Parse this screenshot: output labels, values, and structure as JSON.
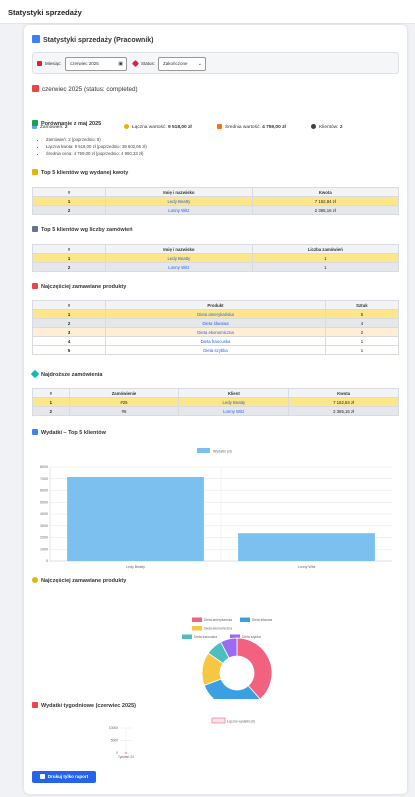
{
  "page_title": "Statystyki sprzedaży",
  "report_title": "Statystyki sprzedaży (Pracownik)",
  "filter": {
    "month_label": "Miesiąc:",
    "month_value": "czerwiec 2025",
    "status_label": "Status:",
    "status_value": "Zakończone"
  },
  "period_heading": "czerwiec 2025 (status: completed)",
  "stats": {
    "orders_label": "Zamówień:",
    "orders_value": "2",
    "total_label": "Łączna wartość:",
    "total_value": "9 518,00 zł",
    "avg_label": "Średnia wartość:",
    "avg_value": "4 759,00 zł",
    "clients_label": "Klientów:",
    "clients_value": "2"
  },
  "comparison": {
    "heading": "Porównanie z maj 2025",
    "items": [
      "Zamówień: 2 (poprzednio: 8)",
      "Łączna kwota: 9 518,00 zł (poprzednio: 39 602,65 zł)",
      "Średnia cena: 4 759,00 zł (poprzednio: 4 950,33 zł)"
    ]
  },
  "top_amount": {
    "heading": "Top 5 klientów wg wydanej kwoty",
    "columns": [
      "#",
      "Imię i nazwisko",
      "Kwota"
    ],
    "rows": [
      [
        "1",
        "Ledy Beatty",
        "7 152,84 zł"
      ],
      [
        "2",
        "Lonny Witz",
        "2 365,16 zł"
      ]
    ]
  },
  "top_orders": {
    "heading": "Top 5 klientów wg liczby zamówień",
    "columns": [
      "#",
      "Imię i nazwisko",
      "Liczba zamówień"
    ],
    "rows": [
      [
        "1",
        "Ledy Beatty",
        "1"
      ],
      [
        "2",
        "Lonny Witz",
        "1"
      ]
    ]
  },
  "top_products": {
    "heading": "Najczęściej zamawiane produkty",
    "columns": [
      "#",
      "Produkt",
      "Sztuk"
    ],
    "rows": [
      [
        "1",
        "Dieta amerykańska",
        "5"
      ],
      [
        "2",
        "Dieta śliwowa",
        "4"
      ],
      [
        "3",
        "Dieta ekonomiczna",
        "2"
      ],
      [
        "4",
        "Dieta francuska",
        "1"
      ],
      [
        "5",
        "Dieta szybka",
        "1"
      ]
    ]
  },
  "expensive_orders": {
    "heading": "Najdroższe zamówienia",
    "columns": [
      "#",
      "Zamówienie",
      "Klient",
      "Kwota"
    ],
    "rows": [
      [
        "1",
        "#25",
        "Ledy Beatty",
        "7 152,84 zł"
      ],
      [
        "2",
        "#6",
        "Lonny Witz",
        "2 365,16 zł"
      ]
    ]
  },
  "bar_heading": "Wydatki – Top 5 klientów",
  "pie_heading": "Najczęściej zamawiane produkty",
  "weekly_heading": "Wydatki tygodniowe (czerwiec 2025)",
  "print_button": "Drukuj tylko raport",
  "colors": {
    "accent": "#2563eb",
    "highlight_1": "#fde68a",
    "highlight_2": "#e5e7ea",
    "bar": "#7cc0ef"
  },
  "chart_data": [
    {
      "type": "bar",
      "title": "",
      "legend": "Wydatki (zł)",
      "categories": [
        "Ledy Beatty",
        "Lonny Witz"
      ],
      "values": [
        7152.84,
        2365.16
      ],
      "ylim": [
        0,
        8000
      ],
      "yticks": [
        "0",
        "1000",
        "2000",
        "3000",
        "4000",
        "5000",
        "6000",
        "7000",
        "8000"
      ]
    },
    {
      "type": "pie",
      "labels": [
        "Dieta amerykańska",
        "Dieta śliwowa",
        "Dieta ekonomiczna",
        "Dieta francuska",
        "Dieta szybka"
      ],
      "values": [
        5,
        4,
        2,
        1,
        1
      ],
      "colors": [
        "#f2627f",
        "#3b9fe3",
        "#f7c744",
        "#4bbfbf",
        "#9b6cf2"
      ]
    },
    {
      "type": "line",
      "legend": "Łączne wydatki (zł)",
      "x": [
        "Tydzień 24"
      ],
      "values": [
        0
      ],
      "yticks": [
        "0",
        "5000",
        "10000"
      ]
    }
  ]
}
